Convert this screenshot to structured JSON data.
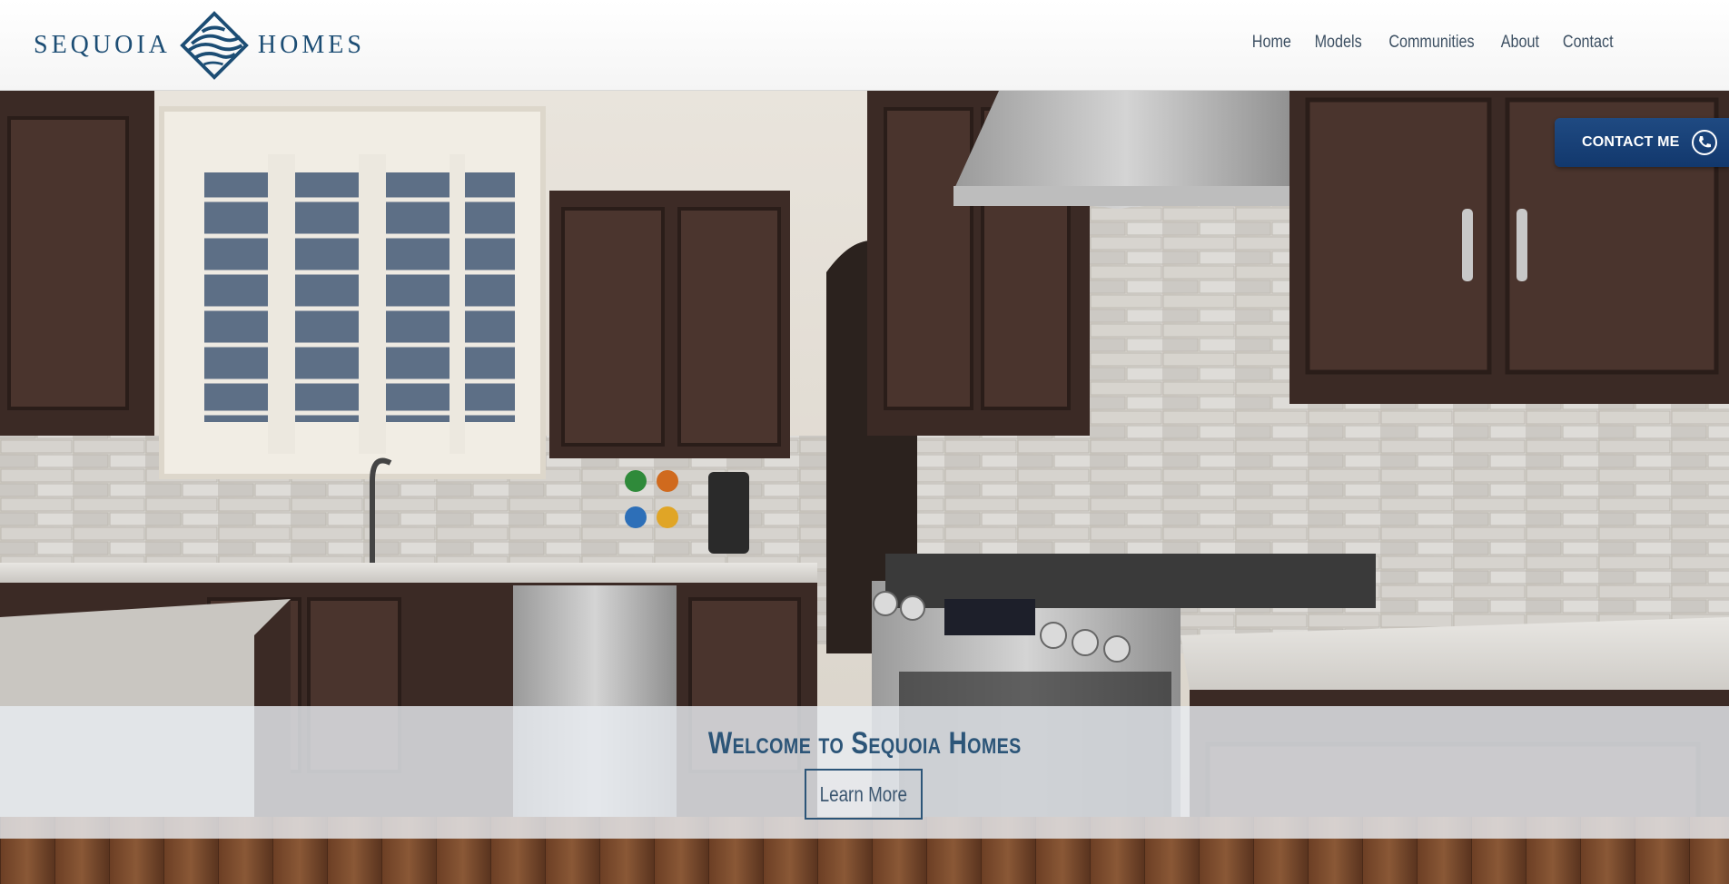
{
  "brand": {
    "name_left": "SEQUOIA",
    "name_right": "HOMES",
    "color": "#1c4d74",
    "mark_icon": "sequoia-diamond-logo-icon"
  },
  "nav": {
    "items": [
      {
        "label": "Home"
      },
      {
        "label": "Models"
      },
      {
        "label": "Communities"
      },
      {
        "label": "About"
      },
      {
        "label": "Contact"
      }
    ]
  },
  "hero": {
    "image_subject": "kitchen-interior",
    "contact_button": {
      "label": "CONTACT ME",
      "icon": "phone-icon",
      "color": "#1a4278"
    },
    "welcome_title": "Welcome to Sequoia Homes",
    "cta_label": "Learn More"
  }
}
